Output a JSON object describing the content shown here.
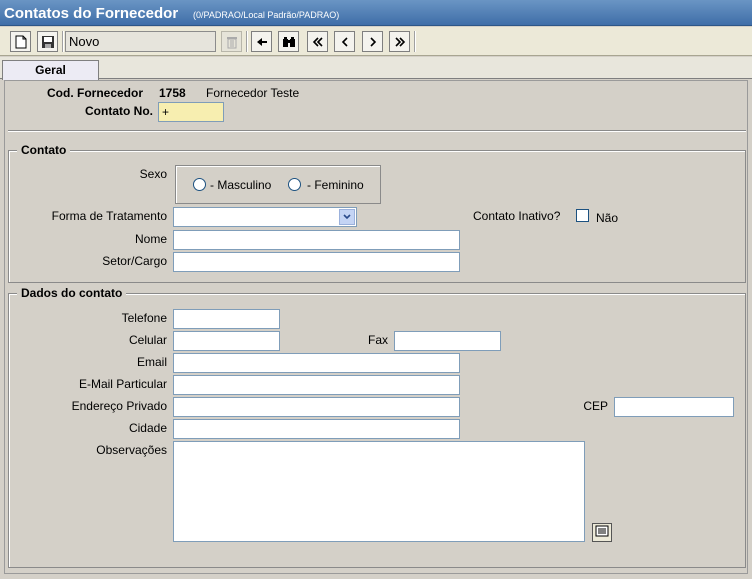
{
  "window": {
    "title": "Contatos do Fornecedor",
    "subtitle": "(0/PADRAO/Local Padrão/PADRAO)"
  },
  "toolbar": {
    "status_value": "Novo",
    "icons": [
      "new-document-icon",
      "save-disk-icon",
      "trash-icon",
      "arrow-left-icon",
      "binoculars-icon",
      "double-chevron-left-icon",
      "chevron-left-icon",
      "chevron-right-icon",
      "double-chevron-right-icon"
    ]
  },
  "tabs": [
    {
      "label": "Geral"
    }
  ],
  "header": {
    "supplier_code_label": "Cod. Fornecedor",
    "supplier_code": "1758",
    "supplier_name": "Fornecedor Teste",
    "contact_no_label": "Contato No.",
    "contact_no_value": "+"
  },
  "contato": {
    "legend": "Contato",
    "sexo_label": "Sexo",
    "masculino_label": "- Masculino",
    "feminino_label": "- Feminino",
    "tratamento_label": "Forma de Tratamento",
    "inativo_label": "Contato Inativo?",
    "nao_label": "Não",
    "nome_label": "Nome",
    "setor_label": "Setor/Cargo"
  },
  "dados": {
    "legend": "Dados do contato",
    "telefone_label": "Telefone",
    "celular_label": "Celular",
    "fax_label": "Fax",
    "email_label": "Email",
    "email_particular_label": "E-Mail Particular",
    "endereco_label": "Endereço Privado",
    "cep_label": "CEP",
    "cidade_label": "Cidade",
    "observacoes_label": "Observações"
  }
}
